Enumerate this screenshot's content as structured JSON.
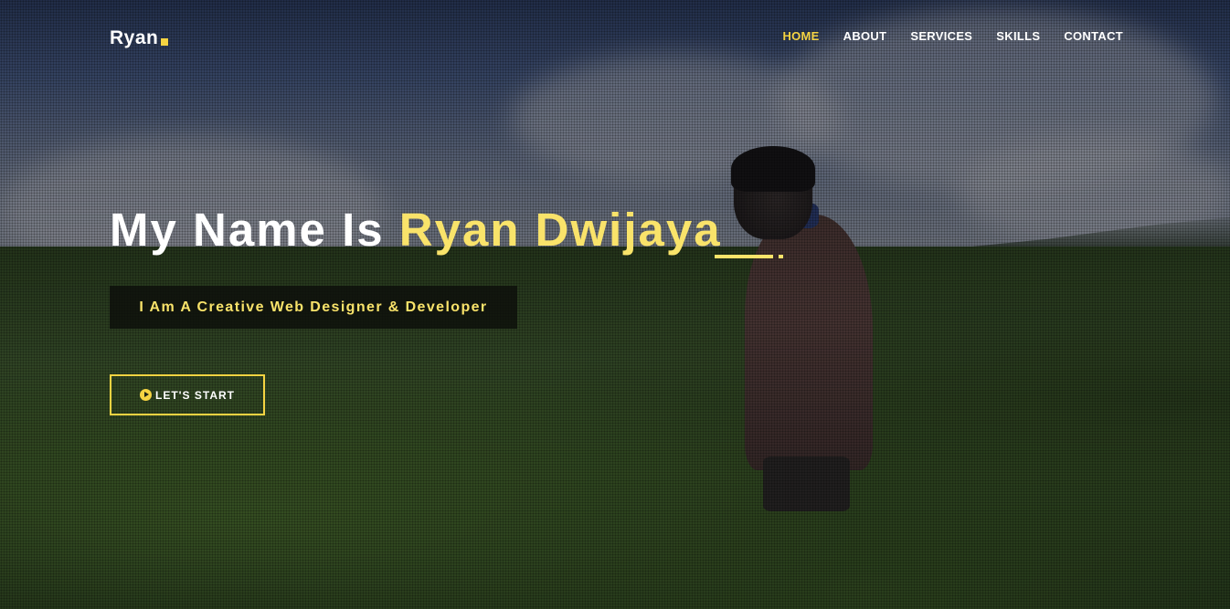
{
  "brand": {
    "name": "Ryan",
    "accent_color": "#f5d342"
  },
  "nav": {
    "items": [
      {
        "label": "HOME",
        "active": true
      },
      {
        "label": "ABOUT",
        "active": false
      },
      {
        "label": "SERVICES",
        "active": false
      },
      {
        "label": "SKILLS",
        "active": false
      },
      {
        "label": "CONTACT",
        "active": false
      }
    ]
  },
  "hero": {
    "headline_prefix": "My Name Is ",
    "headline_name": "Ryan Dwijaya",
    "tagline": "I Am A Creative Web Designer & Developer",
    "cta_label": "LET'S START",
    "cta_icon": "play-circle-icon"
  }
}
